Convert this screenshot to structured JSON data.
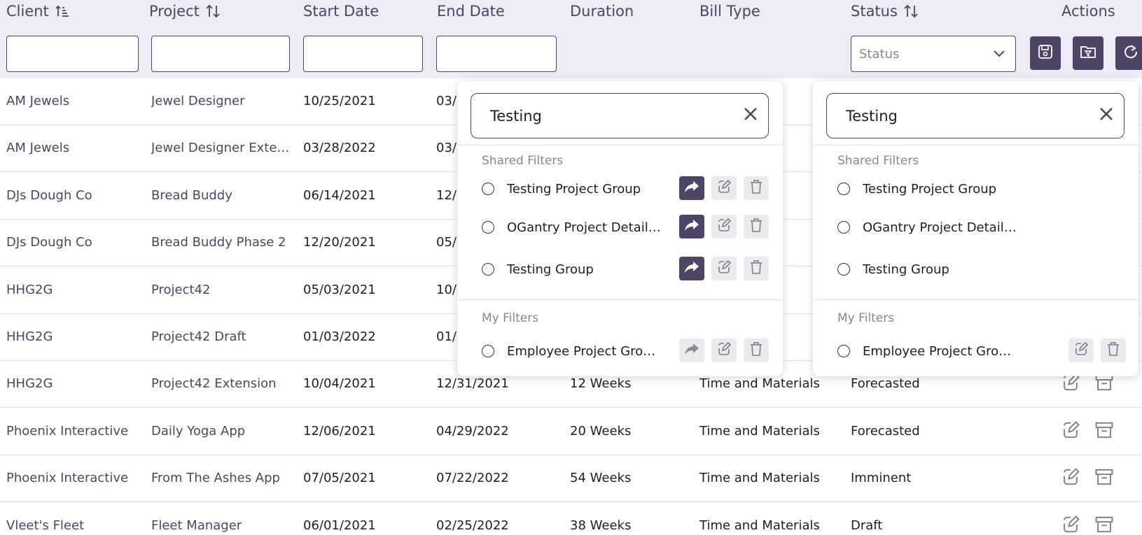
{
  "columns": {
    "client": "Client",
    "project": "Project",
    "start_date": "Start Date",
    "end_date": "End Date",
    "duration": "Duration",
    "bill_type": "Bill Type",
    "status": "Status",
    "actions": "Actions"
  },
  "filters": {
    "status_placeholder": "Status"
  },
  "rows": [
    {
      "client": "AM Jewels",
      "project": "Jewel Designer",
      "start": "10/25/2021",
      "end": "03/",
      "duration": "",
      "bill": "erials",
      "status": ""
    },
    {
      "client": "AM Jewels",
      "project": "Jewel Designer Exten…",
      "start": "03/28/2022",
      "end": "03/",
      "duration": "",
      "bill": "erials",
      "status": ""
    },
    {
      "client": "DJs Dough Co",
      "project": "Bread Buddy",
      "start": "06/14/2021",
      "end": "12/1",
      "duration": "",
      "bill": "erials",
      "status": ""
    },
    {
      "client": "DJs Dough Co",
      "project": "Bread Buddy Phase 2",
      "start": "12/20/2021",
      "end": "05/",
      "duration": "",
      "bill": "erials",
      "status": ""
    },
    {
      "client": "HHG2G",
      "project": "Project42",
      "start": "05/03/2021",
      "end": "10/",
      "duration": "",
      "bill": "erials",
      "status": ""
    },
    {
      "client": "HHG2G",
      "project": "Project42 Draft",
      "start": "01/03/2022",
      "end": "01/1",
      "duration": "",
      "bill": "erials",
      "status": ""
    },
    {
      "client": "HHG2G",
      "project": "Project42 Extension",
      "start": "10/04/2021",
      "end": "12/31/2021",
      "duration": "12 Weeks",
      "bill": "Time and Materials",
      "status": "Forecasted"
    },
    {
      "client": "Phoenix Interactive",
      "project": "Daily Yoga App",
      "start": "12/06/2021",
      "end": "04/29/2022",
      "duration": "20 Weeks",
      "bill": "Time and Materials",
      "status": "Forecasted"
    },
    {
      "client": "Phoenix Interactive",
      "project": "From The Ashes App",
      "start": "07/05/2021",
      "end": "07/22/2022",
      "duration": "54 Weeks",
      "bill": "Time and Materials",
      "status": "Imminent"
    },
    {
      "client": "Vleet's Fleet",
      "project": "Fleet Manager",
      "start": "06/01/2021",
      "end": "02/25/2022",
      "duration": "38 Weeks",
      "bill": "Time and Materials",
      "status": "Draft"
    }
  ],
  "panels": [
    {
      "search_value": "Testing",
      "shared_label": "Shared Filters",
      "my_label": "My Filters",
      "shared_items": [
        "Testing Project Group",
        "OGantry Project Detail…",
        "Testing Group"
      ],
      "my_items": [
        "Employee Project Gro…"
      ]
    },
    {
      "search_value": "Testing",
      "shared_label": "Shared Filters",
      "my_label": "My Filters",
      "shared_items": [
        "Testing Project Group",
        "OGantry Project Detail…",
        "Testing Group"
      ],
      "my_items": [
        "Employee Project Gro…"
      ]
    }
  ],
  "colors": {
    "accent": "#4d4466",
    "header_bg": "#ecebf6",
    "disabled_btn": "#ebebef"
  }
}
